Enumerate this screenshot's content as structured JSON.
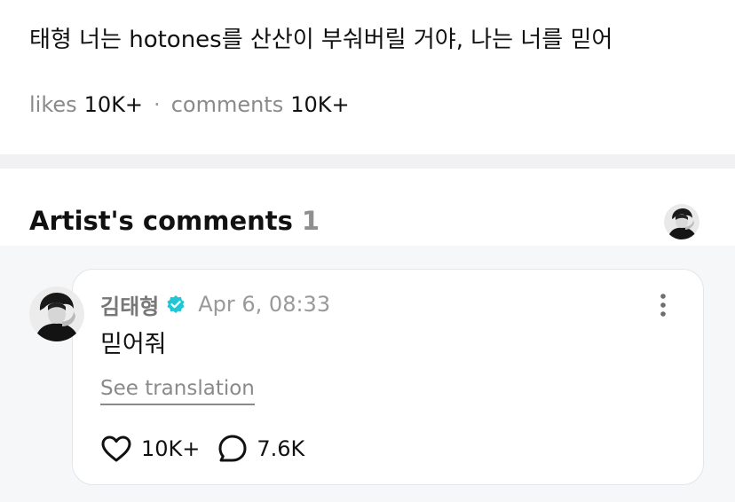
{
  "post": {
    "text": "태형 너는 hotones를 산산이 부숴버릴 거야, 나는 너를 믿어",
    "likes_label": "likes",
    "likes_count": "10K+",
    "separator": "·",
    "comments_label": "comments",
    "comments_count": "10K+"
  },
  "artist_comments": {
    "title": "Artist's comments",
    "count": "1",
    "header_avatar_icon": "artist-avatar",
    "items": [
      {
        "author": "김태형",
        "verified_icon": "verified-badge-icon",
        "verified_color": "#1fc6d6",
        "time": "Apr 6, 08:33",
        "text": "믿어줘",
        "see_translation": "See translation",
        "likes": "10K+",
        "replies": "7.6K",
        "avatar_icon": "artist-avatar"
      }
    ]
  },
  "colors": {
    "background": "#ffffff",
    "divider_band": "#f1f1f3",
    "comments_background": "#f6f7f9",
    "card_border": "#e4e5ea",
    "muted_text": "#8a8a8a"
  }
}
